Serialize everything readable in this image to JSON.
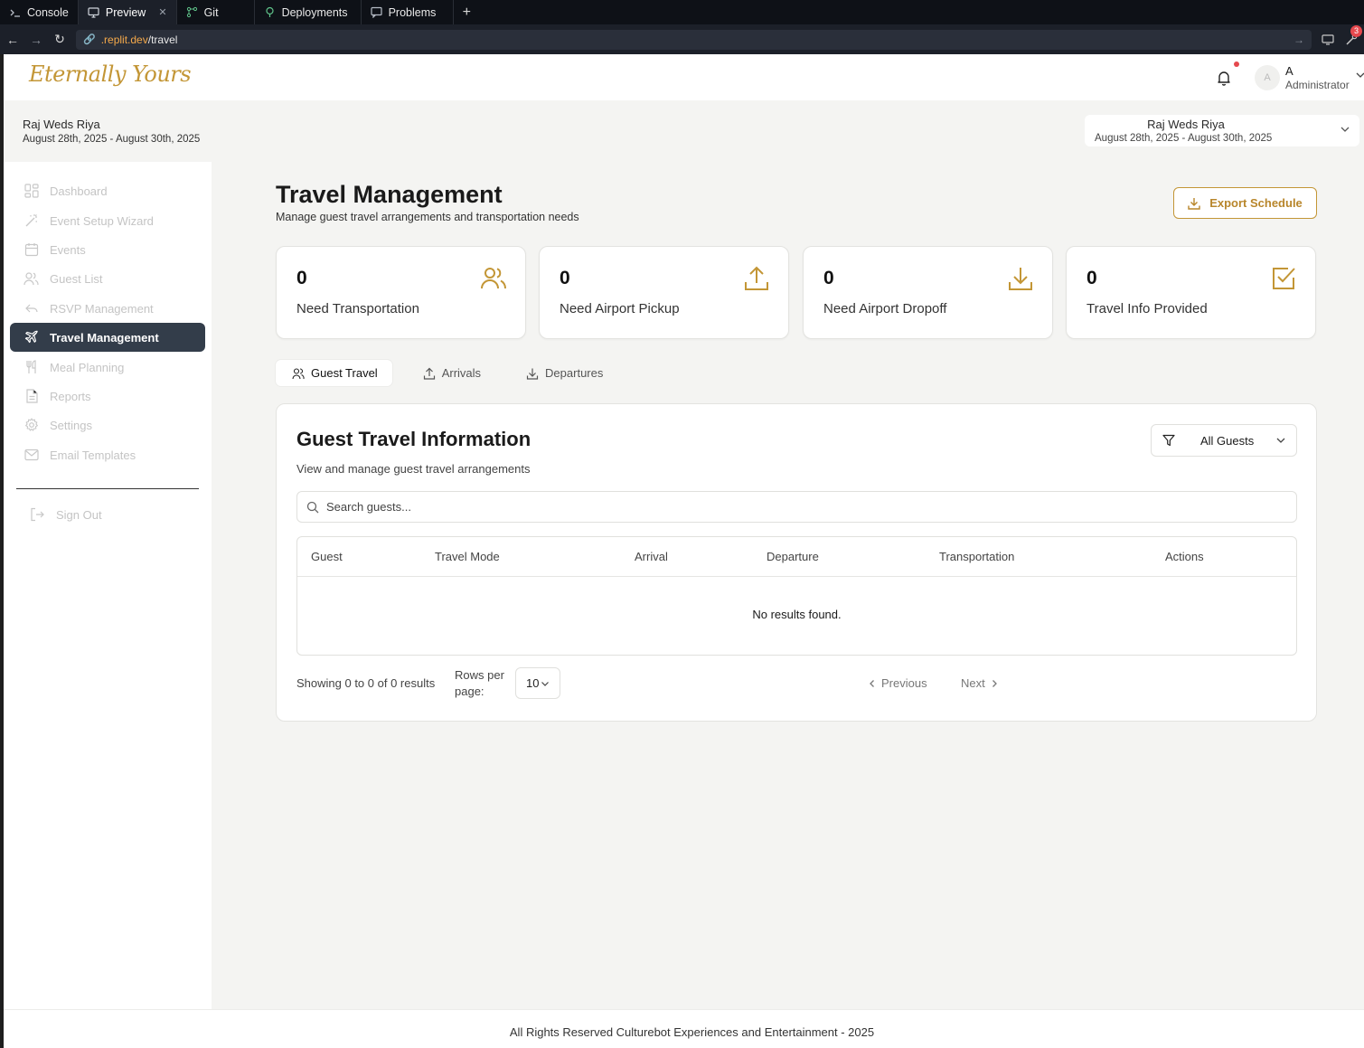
{
  "browser": {
    "tabs": [
      {
        "label": "Console",
        "icon": "terminal-icon"
      },
      {
        "label": "Preview",
        "icon": "monitor-icon"
      },
      {
        "label": "Git",
        "icon": "git-icon"
      },
      {
        "label": "Deployments",
        "icon": "deploy-icon"
      },
      {
        "label": "Problems",
        "icon": "message-icon"
      }
    ],
    "add_tab": "+",
    "url_host": ".replit.dev",
    "url_path": "/travel",
    "notification_count": "3"
  },
  "header": {
    "logo": "Eternally Yours",
    "user_initial": "A",
    "user_name": "A",
    "user_role": "Administrator"
  },
  "event": {
    "title": "Raj Weds Riya",
    "dates": "August 28th, 2025 - August 30th, 2025"
  },
  "sidebar": {
    "items": [
      {
        "label": "Dashboard",
        "icon": "dashboard-icon"
      },
      {
        "label": "Event Setup Wizard",
        "icon": "wand-icon"
      },
      {
        "label": "Events",
        "icon": "calendar-icon"
      },
      {
        "label": "Guest List",
        "icon": "users-icon"
      },
      {
        "label": "RSVP Management",
        "icon": "reply-icon"
      },
      {
        "label": "Travel Management",
        "icon": "plane-icon",
        "active": true
      },
      {
        "label": "Meal Planning",
        "icon": "utensils-icon"
      },
      {
        "label": "Reports",
        "icon": "file-icon"
      },
      {
        "label": "Settings",
        "icon": "gear-icon"
      },
      {
        "label": "Email Templates",
        "icon": "mail-icon"
      }
    ],
    "sign_out": "Sign Out"
  },
  "main": {
    "title": "Travel Management",
    "subtitle": "Manage guest travel arrangements and transportation needs",
    "export_label": "Export Schedule",
    "stats": [
      {
        "value": "0",
        "label": "Need Transportation",
        "icon": "users-icon"
      },
      {
        "value": "0",
        "label": "Need Airport Pickup",
        "icon": "upload-icon"
      },
      {
        "value": "0",
        "label": "Need Airport Dropoff",
        "icon": "download-icon"
      },
      {
        "value": "0",
        "label": "Travel Info Provided",
        "icon": "check-square-icon"
      }
    ],
    "tabs": [
      {
        "label": "Guest Travel",
        "icon": "users-icon"
      },
      {
        "label": "Arrivals",
        "icon": "upload-icon"
      },
      {
        "label": "Departures",
        "icon": "download-icon"
      }
    ],
    "panel": {
      "title": "Guest Travel Information",
      "subtitle": "View and manage guest travel arrangements",
      "filter_value": "All Guests",
      "search_placeholder": "Search guests...",
      "columns": [
        "Guest",
        "Travel Mode",
        "Arrival",
        "Departure",
        "Transportation",
        "Actions"
      ],
      "empty_text": "No results found.",
      "showing": "Showing 0 to 0 of 0 results",
      "rows_per_page_label": "Rows per page:",
      "rows_per_page_value": "10",
      "previous": "Previous",
      "next": "Next"
    }
  },
  "footer": {
    "text": "All Rights Reserved Culturebot Experiences and Entertainment - 2025"
  },
  "colors": {
    "accent_gold": "#c39636",
    "sidebar_active": "#333d4a",
    "notification_red": "#e5484d"
  }
}
